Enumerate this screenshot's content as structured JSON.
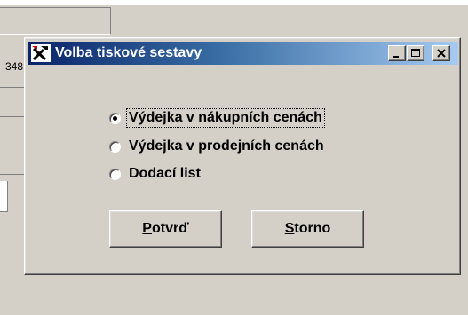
{
  "background": {
    "partial_text": "348"
  },
  "dialog": {
    "title": "Volba tiskové sestavy",
    "icon": "hammer-and-pick-icon",
    "title_buttons": [
      "minimize-icon",
      "maximize-icon",
      "close-icon"
    ],
    "report_options": [
      {
        "label": "Výdejka v nákupních cenách",
        "selected": true
      },
      {
        "label": "Výdejka v prodejních cenách",
        "selected": false
      },
      {
        "label": "Dodací list",
        "selected": false
      }
    ],
    "buttons": {
      "confirm": {
        "accel": "P",
        "rest": "otvrď"
      },
      "cancel": {
        "accel": "S",
        "rest": "torno"
      }
    }
  },
  "colors": {
    "face": "#d4d0c8",
    "title_start": "#0a246a",
    "title_end": "#a6caf0"
  }
}
